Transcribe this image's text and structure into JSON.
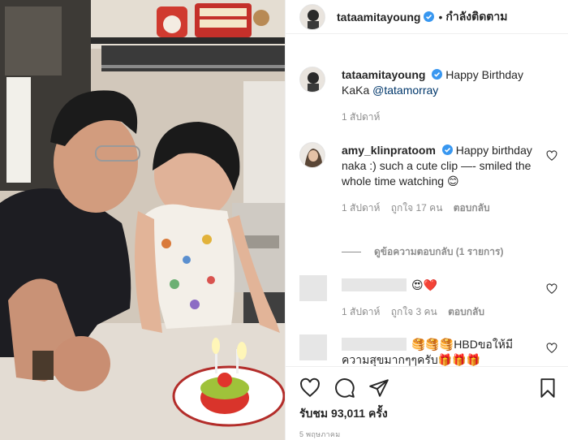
{
  "post": {
    "author": "tataamitayoung",
    "follow_label": "กำลังติดตาม",
    "dot": "•"
  },
  "caption": {
    "username": "tataamitayoung",
    "text": "Happy Birthday KaKa ",
    "mention": "@tatamorray",
    "time": "1 สัปดาห์"
  },
  "comments": [
    {
      "username": "amy_klinpratoom",
      "text": "Happy birthday naka :) such a cute clip —- smiled the whole time watching 😊",
      "time": "1 สัปดาห์",
      "likes": "ถูกใจ 17 คน",
      "reply": "ตอบกลับ",
      "view_replies": "ดูข้อความตอบกลับ (1 รายการ)"
    },
    {
      "username_hidden": true,
      "text": "😍❤️",
      "time": "1 สัปดาห์",
      "likes": "ถูกใจ 3 คน",
      "reply": "ตอบกลับ"
    },
    {
      "username_hidden": true,
      "text": "🥞🥞🥞HBDขอให้มีความสุขมากๆๆครับ🎁🎁🎁"
    }
  ],
  "actions": {
    "like_icon": "heart-outline-icon",
    "comment_icon": "comment-bubble-icon",
    "share_icon": "paper-plane-icon",
    "save_icon": "bookmark-icon"
  },
  "views": "รับชม 93,011 ครั้ง",
  "date": "5 พฤษภาคม",
  "colors": {
    "verified": "#3897f0",
    "mention": "#00376b",
    "meta": "#8e8e8e",
    "divider": "#efefef"
  }
}
